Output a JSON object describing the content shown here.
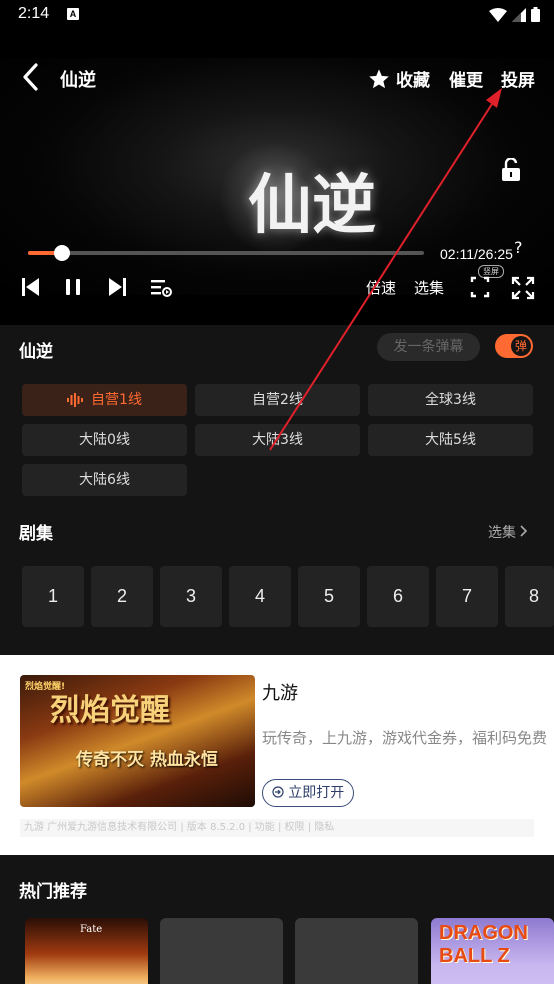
{
  "status_bar": {
    "time": "2:14",
    "notification_badge": "A"
  },
  "player": {
    "title": "仙逆",
    "favorite_label": "收藏",
    "urge_label": "催更",
    "cast_label": "投屏",
    "video_watermark": "仙逆",
    "timecode": "02:11/26:25",
    "help_mark": "?",
    "progress_fraction": 0.085,
    "speed_label": "倍速",
    "episodes_label": "选集",
    "screen_badge": "竖屏"
  },
  "info": {
    "title": "仙逆",
    "danmaku_placeholder": "发一条弹幕",
    "danmaku_toggle_label": "弹",
    "lines": [
      {
        "label": "自营1线",
        "active": true
      },
      {
        "label": "自营2线",
        "active": false
      },
      {
        "label": "全球3线",
        "active": false
      },
      {
        "label": "大陆0线",
        "active": false
      },
      {
        "label": "大陆3线",
        "active": false
      },
      {
        "label": "大陆5线",
        "active": false
      },
      {
        "label": "大陆6线",
        "active": false
      }
    ],
    "episodes_title": "剧集",
    "select_episodes": "选集",
    "episodes": [
      "1",
      "2",
      "3",
      "4",
      "5",
      "6",
      "7",
      "8"
    ]
  },
  "ad": {
    "image_headline": "烈焰觉醒",
    "image_subtitle": "传奇不灭 热血永恒",
    "image_tag": "烈焰觉醒!",
    "name": "九游",
    "description": "玩传奇，上九游，游戏代金券，福利码免费",
    "open_label": "立即打开",
    "footer": "九游 广州爱九游信息技术有限公司 | 版本 8.5.2.0 | 功能 | 权限 | 隐私"
  },
  "hot": {
    "title": "热门推荐",
    "db_logo": "DRAGON BALL Z",
    "fate_logo": "Fate"
  },
  "colors": {
    "accent": "#ff6a32",
    "background": "#141414",
    "annotation_arrow": "#e0202a"
  }
}
